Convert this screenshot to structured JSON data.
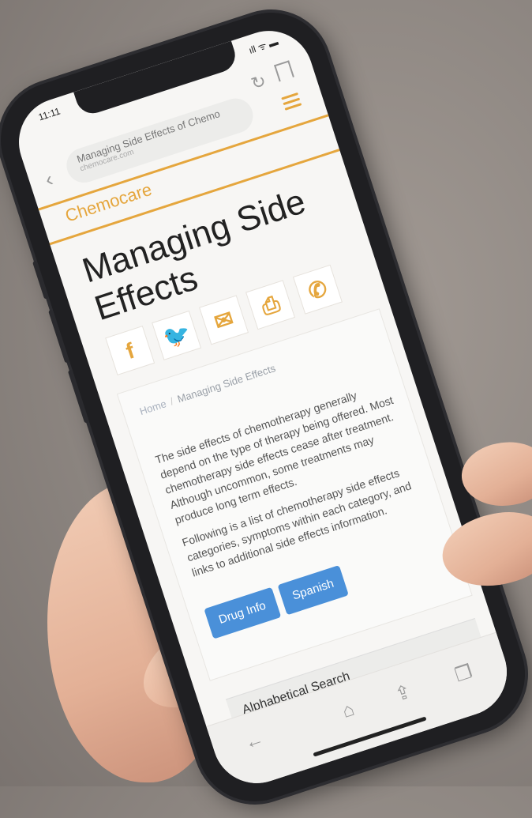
{
  "status_bar": {
    "time": "11:11",
    "icons": "ıll ᯤ ▬"
  },
  "browser": {
    "url_title": "Managing Side Effects of Chemo",
    "url_domain": "chemocare.com",
    "reload_icon": "reload-icon",
    "bookmark_icon": "bookmark-icon",
    "menu_icon": "hamburger-menu-icon"
  },
  "site": {
    "brand": "Chemocare"
  },
  "page": {
    "title": "Managing Side Effects",
    "share_buttons": [
      {
        "icon": "facebook-icon",
        "glyph": "f"
      },
      {
        "icon": "twitter-icon",
        "glyph": "🐦"
      },
      {
        "icon": "email-icon",
        "glyph": "✉"
      },
      {
        "icon": "print-icon",
        "glyph": "⎙"
      },
      {
        "icon": "phone-icon",
        "glyph": "✆"
      }
    ],
    "breadcrumb": {
      "home": "Home",
      "current": "Managing Side Effects"
    },
    "paragraph1": "The side effects of chemotherapy generally depend on the type of therapy being offered. Most chemotherapy side effects cease after treatment. Although uncommon, some treatments may produce long term effects.",
    "paragraph2": "Following is a list of chemotherapy side effects categories, symptoms within each category, and links to additional side effects information.",
    "buttons": {
      "drug_info": "Drug Info",
      "spanish": "Spanish"
    },
    "section": "Alphabetical Search"
  },
  "colors": {
    "accent": "#e5a63d",
    "button": "#4a90d9"
  }
}
